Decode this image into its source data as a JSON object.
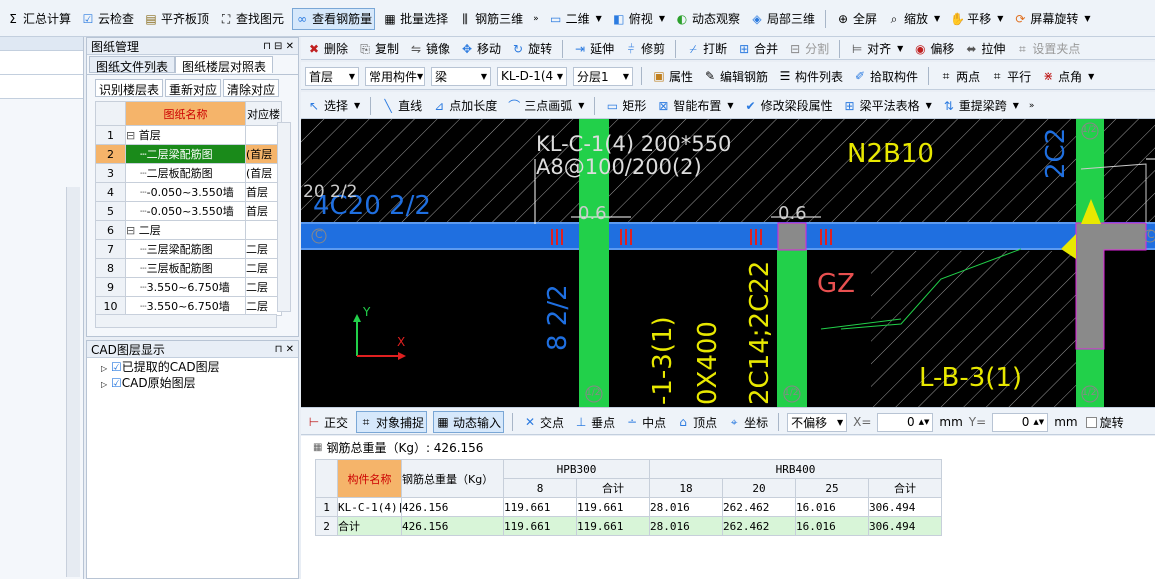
{
  "toolbar1": {
    "items": [
      "汇总计算",
      "云检查",
      "平齐板顶",
      "查找图元",
      "查看钢筋量",
      "批量选择",
      "钢筋三维",
      "二维",
      "俯视",
      "动态观察",
      "局部三维",
      "全屏",
      "缩放",
      "平移",
      "屏幕旋转"
    ]
  },
  "toolbar2": {
    "items": [
      "删除",
      "复制",
      "镜像",
      "移动",
      "旋转",
      "延伸",
      "修剪",
      "打断",
      "合并",
      "分割",
      "对齐",
      "偏移",
      "拉伸",
      "设置夹点"
    ]
  },
  "toolbar3": {
    "floor": "首层",
    "category": "常用构件",
    "type": "梁",
    "element": "KL-D-1(4",
    "layer": "分层1",
    "items": [
      "属性",
      "编辑钢筋",
      "构件列表",
      "拾取构件",
      "两点",
      "平行",
      "点角"
    ]
  },
  "toolbar4": {
    "items": [
      "选择",
      "直线",
      "点加长度",
      "三点画弧",
      "矩形",
      "智能布置",
      "修改梁段属性",
      "梁平法表格",
      "重提梁跨"
    ]
  },
  "drawing_panel": {
    "title": "图纸管理",
    "tabs": [
      "图纸文件列表",
      "图纸楼层对照表"
    ],
    "buttons": [
      "识别楼层表",
      "重新对应",
      "清除对应"
    ],
    "columns": [
      "图纸名称",
      "对应楼"
    ],
    "rows": [
      {
        "num": "1",
        "name": "首层",
        "floor": "",
        "group": true
      },
      {
        "num": "2",
        "name": "二层梁配筋图",
        "floor": "(首层",
        "group": false,
        "selected": true
      },
      {
        "num": "3",
        "name": "二层板配筋图",
        "floor": "(首层",
        "group": false
      },
      {
        "num": "4",
        "name": "-0.050~3.550墙",
        "floor": "首层",
        "group": false
      },
      {
        "num": "5",
        "name": "-0.050~3.550墙",
        "floor": "首层",
        "group": false
      },
      {
        "num": "6",
        "name": "二层",
        "floor": "",
        "group": true
      },
      {
        "num": "7",
        "name": "三层梁配筋图",
        "floor": "二层",
        "group": false
      },
      {
        "num": "8",
        "name": "三层板配筋图",
        "floor": "二层",
        "group": false
      },
      {
        "num": "9",
        "name": "3.550~6.750墙",
        "floor": "二层",
        "group": false
      },
      {
        "num": "10",
        "name": "3.550~6.750墙",
        "floor": "二层",
        "group": false
      }
    ]
  },
  "cad_panel": {
    "title": "CAD图层显示",
    "layers": [
      "已提取的CAD图层",
      "CAD原始图层"
    ]
  },
  "canvas": {
    "labels": [
      "KL-C-1(4) 200*550",
      "A8@100/200(2)",
      "N2B10",
      "4C20 2/2",
      "20 2/2",
      "0.6",
      "0.6",
      "GZ",
      "L-B-3(1)",
      "8 2/2",
      "-1-3(1)",
      "0X400",
      "2C14;2C22",
      "2C2",
      "C",
      "C",
      "1/2",
      "1/2",
      "1/2",
      "1/2"
    ],
    "axis_y": "Y",
    "axis_x": "X"
  },
  "snapbar": {
    "items": [
      "正交",
      "对象捕捉",
      "动态输入",
      "交点",
      "垂点",
      "中点",
      "顶点",
      "坐标"
    ],
    "offset": "不偏移",
    "x_label": "X=",
    "x_value": "0",
    "y_label": "Y=",
    "y_value": "0",
    "unit": "mm",
    "rotate": "旋转"
  },
  "rebar": {
    "total": "钢筋总重量（Kg）: 426.156",
    "header_member": "构件名称",
    "header_total": "钢筋总重量（Kg）",
    "group1": "HPB300",
    "group2": "HRB400",
    "subheaders": [
      "8",
      "合计",
      "18",
      "20",
      "25",
      "合计"
    ],
    "rows": [
      {
        "num": "1",
        "name": "KL-C-1(4)[",
        "values": [
          "426.156",
          "119.661",
          "119.661",
          "28.016",
          "262.462",
          "16.016",
          "306.494"
        ]
      },
      {
        "num": "2",
        "name": "合计",
        "values": [
          "426.156",
          "119.661",
          "119.661",
          "28.016",
          "262.462",
          "16.016",
          "306.494"
        ]
      }
    ]
  },
  "colors": {
    "canvas_bg": "#000000",
    "green": "#22d04a",
    "blue": "#1f6fe0",
    "yellow": "#e8e800",
    "red": "#e02020"
  }
}
